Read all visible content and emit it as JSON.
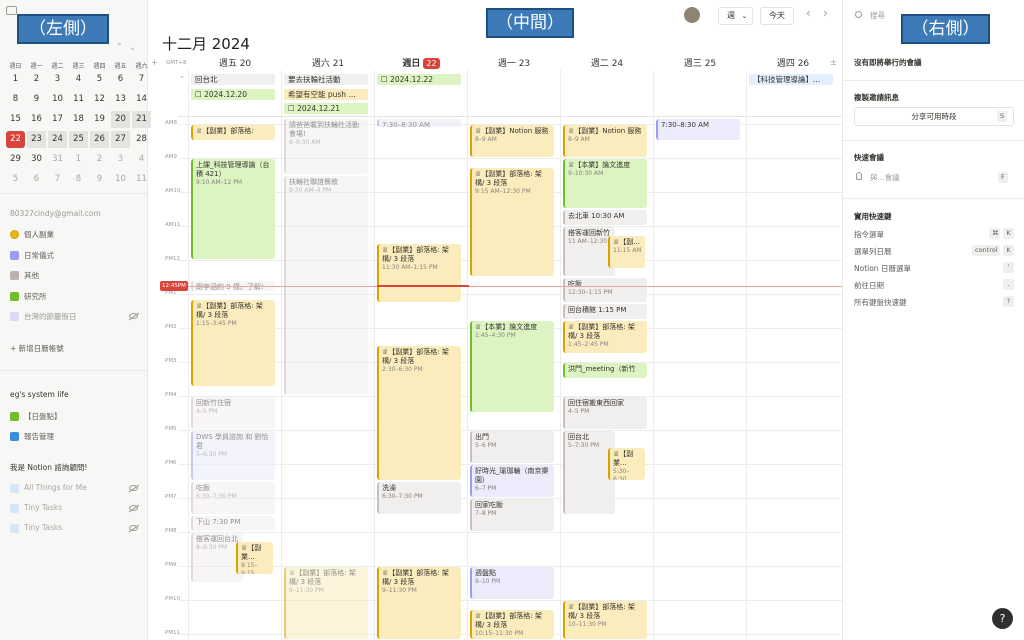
{
  "annotations": {
    "left": "（左側）",
    "center": "（中間）",
    "right": "（右側）"
  },
  "mini_cal": {
    "weekdays": [
      "週日",
      "週一",
      "週二",
      "週三",
      "週四",
      "週五",
      "週六"
    ],
    "days": [
      "1",
      "2",
      "3",
      "4",
      "5",
      "6",
      "7",
      "8",
      "9",
      "10",
      "11",
      "12",
      "13",
      "14",
      "15",
      "16",
      "17",
      "18",
      "19",
      "20",
      "21",
      "22",
      "23",
      "24",
      "25",
      "26",
      "27",
      "28",
      "29",
      "30",
      "31",
      "1",
      "2",
      "3",
      "4",
      "5",
      "6",
      "7",
      "8",
      "9",
      "10",
      "11"
    ]
  },
  "left_sidebar": {
    "account": "80327cindy@gmail.com",
    "calendars": [
      "個人副業",
      "日常儀式",
      "其他",
      "研究所",
      "台灣的節慶假日"
    ],
    "add_calendar": "新增日曆帳號",
    "system_section": "eg's system life",
    "system_items": [
      "【日盤點】",
      "報告管理"
    ],
    "notion_section": "我是 Notion 諮詢顧問!",
    "notion_items": [
      "All Things for Me",
      "Tiny Tasks",
      "Tiny Tasks"
    ]
  },
  "header": {
    "title": "十二月 2024",
    "view": "週",
    "view_caret": "⌄",
    "today": "今天",
    "prev": "‹",
    "next": "›",
    "timezone": "GMT+8",
    "add": "+",
    "collapse": "⌃",
    "expand": "±"
  },
  "columns": [
    {
      "day": "週五 20"
    },
    {
      "day": "週六 21"
    },
    {
      "day": "週日",
      "num": "22"
    },
    {
      "day": "週一 23"
    },
    {
      "day": "週二 24"
    },
    {
      "day": "週三 25"
    },
    {
      "day": "週四 26"
    }
  ],
  "hours": [
    "AM8",
    "AM9",
    "AM10",
    "AM11",
    "PM12",
    "PM1",
    "PM2",
    "PM3",
    "PM4",
    "PM5",
    "PM6",
    "PM7",
    "PM8",
    "PM9",
    "PM10",
    "PM11"
  ],
  "now_label": "12:45PM",
  "allday": [
    {
      "col": 0,
      "row": 0,
      "text": "回台北",
      "c": "gry"
    },
    {
      "col": 0,
      "row": 1,
      "text": "☐ 2024.12.20",
      "c": "grn"
    },
    {
      "col": 1,
      "row": 0,
      "text": "要去扶輪社活動",
      "c": "gry"
    },
    {
      "col": 1,
      "row": 1,
      "text": "希望有空能 push ...",
      "c": "yel"
    },
    {
      "col": 1,
      "row": 2,
      "text": "☐ 2024.12.21",
      "c": "grn"
    },
    {
      "col": 2,
      "row": 0,
      "text": "☐ 2024.12.22",
      "c": "grn"
    },
    {
      "col": 6,
      "row": 0,
      "text": "【科技管理導論】...",
      "c": "blu"
    }
  ],
  "events": [
    {
      "col": 0,
      "s": 8.0,
      "e": 8.5,
      "t": "♕【副業】部落格:",
      "tm": "",
      "c": "yel stripe"
    },
    {
      "col": 0,
      "s": 9.0,
      "e": 12.0,
      "t": "上課_科技管理導論（台積 421）",
      "tm": "9:10 AM–12 PM",
      "c": "grn stripeg"
    },
    {
      "col": 0,
      "s": 12.6,
      "e": 12.95,
      "t": "跟宇涵約 9 樣。了解!",
      "tm": "",
      "c": "gry stripegr faded"
    },
    {
      "col": 0,
      "s": 13.15,
      "e": 15.75,
      "t": "♕【副業】部落格: 架構/ 3 段落",
      "tm": "1:15–3:45 PM",
      "c": "yel stripe"
    },
    {
      "col": 0,
      "s": 16.0,
      "e": 17.0,
      "t": "回新竹住宿",
      "tm": "4–5 PM",
      "c": "gry stripegr faded"
    },
    {
      "col": 0,
      "s": 17.0,
      "e": 18.5,
      "t": "DWS 學員諮詢 和 劉怡君",
      "tm": "5–6:30 PM",
      "c": "pur stripep faded"
    },
    {
      "col": 0,
      "s": 18.5,
      "e": 19.5,
      "t": "吃飯",
      "tm": "6:30–7:30 PM",
      "c": "gry stripegr faded"
    },
    {
      "col": 0,
      "s": 19.5,
      "e": 20.0,
      "t": "下山 7:30 PM",
      "tm": "",
      "c": "gry stripegr faded"
    },
    {
      "col": 0,
      "s": 20.0,
      "e": 21.5,
      "t": "搭客運回台北",
      "tm": "8–9:30 PM",
      "c": "gry stripegr faded"
    },
    {
      "col": 0,
      "s": 20.25,
      "e": 21.25,
      "t": "♕【副業...",
      "tm": "8:15–9:15",
      "c": "yel stripe",
      "half": true
    },
    {
      "col": 1,
      "s": 7.8,
      "e": 9.5,
      "t": "請爸爸載到扶輪社活動會場!",
      "tm": "8–9:30 AM",
      "c": "gry stripegr faded"
    },
    {
      "col": 1,
      "s": 9.5,
      "e": 16.0,
      "t": "扶輪社聯誼餐敘",
      "tm": "9:30 AM–4 PM",
      "c": "gry stripegr faded"
    },
    {
      "col": 1,
      "s": 21.0,
      "e": 24.0,
      "t": "♕【副業】部落格: 架構/ 3 段落",
      "tm": "9–11:30 PM",
      "c": "yel stripe faded"
    },
    {
      "col": 2,
      "s": 7.8,
      "e": 8.1,
      "t": "7:30–8:30 AM",
      "tm": "",
      "c": "pur stripep faded"
    },
    {
      "col": 2,
      "s": 11.5,
      "e": 13.25,
      "t": "♕【副業】部落格: 架構/ 3 段落",
      "tm": "11:30 AM–1:15 PM",
      "c": "yel stripe"
    },
    {
      "col": 2,
      "s": 14.5,
      "e": 18.5,
      "t": "♕【副業】部落格: 架構/ 3 段落",
      "tm": "2:30–6:30 PM",
      "c": "yel stripe"
    },
    {
      "col": 2,
      "s": 18.5,
      "e": 19.5,
      "t": "洗澡",
      "tm": "6:30–7:30 PM",
      "c": "gry stripegr"
    },
    {
      "col": 2,
      "s": 21.0,
      "e": 24.0,
      "t": "♕【副業】部落格: 架構/ 3 段落",
      "tm": "9–11:30 PM",
      "c": "yel stripe"
    },
    {
      "col": 3,
      "s": 8.0,
      "e": 9.0,
      "t": "♕【副業】Notion 服務",
      "tm": "8–9 AM",
      "c": "yel stripe"
    },
    {
      "col": 3,
      "s": 9.25,
      "e": 12.5,
      "t": "♕【副業】部落格: 架構/ 3 段落",
      "tm": "9:15 AM–12:30 PM",
      "c": "yel stripe"
    },
    {
      "col": 3,
      "s": 13.75,
      "e": 16.5,
      "t": "♕【本業】論文進度",
      "tm": "1:45–4:30 PM",
      "c": "grn stripeg"
    },
    {
      "col": 3,
      "s": 17.0,
      "e": 18.0,
      "t": "出門",
      "tm": "5–6 PM",
      "c": "gry stripegr"
    },
    {
      "col": 3,
      "s": 18.0,
      "e": 19.0,
      "t": "好時光_瑜珈輪（南京樂園）",
      "tm": "6–7 PM",
      "c": "pur stripep"
    },
    {
      "col": 3,
      "s": 19.0,
      "e": 20.0,
      "t": "回家吃飯",
      "tm": "7–8 PM",
      "c": "gry stripegr"
    },
    {
      "col": 3,
      "s": 21.0,
      "e": 22.0,
      "t": "週盤點",
      "tm": "9–10 PM",
      "c": "pur stripep"
    },
    {
      "col": 3,
      "s": 22.25,
      "e": 24.0,
      "t": "♕【副業】部落格: 架構/ 3 段落",
      "tm": "10:15–11:30 PM",
      "c": "yel stripe"
    },
    {
      "col": 4,
      "s": 8.0,
      "e": 9.0,
      "t": "♕【副業】Notion 服務",
      "tm": "8–9 AM",
      "c": "yel stripe"
    },
    {
      "col": 4,
      "s": 9.0,
      "e": 10.5,
      "t": "♕【本業】論文進度",
      "tm": "9–10:30 AM",
      "c": "grn stripeg"
    },
    {
      "col": 4,
      "s": 10.5,
      "e": 11.0,
      "t": "去北車 10:30 AM",
      "tm": "",
      "c": "gry stripegr"
    },
    {
      "col": 4,
      "s": 11.0,
      "e": 12.5,
      "t": "搭客運回新竹",
      "tm": "11 AM–12:30",
      "c": "gry stripegr"
    },
    {
      "col": 4,
      "s": 11.25,
      "e": 12.25,
      "t": "♕【副...",
      "tm": "11:15 AM",
      "c": "yel stripe",
      "half": true
    },
    {
      "col": 4,
      "s": 12.5,
      "e": 13.25,
      "t": "吃飯",
      "tm": "12:30–1:15 PM",
      "c": "gry stripegr"
    },
    {
      "col": 4,
      "s": 13.25,
      "e": 13.75,
      "t": "回台積館 1:15 PM",
      "tm": "",
      "c": "gry stripegr"
    },
    {
      "col": 4,
      "s": 13.75,
      "e": 14.75,
      "t": "♕【副業】部落格: 架構/ 3 段落",
      "tm": "1:45–2:45 PM",
      "c": "yel stripe"
    },
    {
      "col": 4,
      "s": 15.0,
      "e": 15.5,
      "t": "洪門_meeting（新竹",
      "tm": "",
      "c": "grn stripeg"
    },
    {
      "col": 4,
      "s": 16.0,
      "e": 17.0,
      "t": "回住宿搬東西回家",
      "tm": "4–5 PM",
      "c": "gry stripegr"
    },
    {
      "col": 4,
      "s": 17.0,
      "e": 19.5,
      "t": "回台北",
      "tm": "5–7:30 PM",
      "c": "gry stripegr"
    },
    {
      "col": 4,
      "s": 17.5,
      "e": 18.5,
      "t": "♕【副業...",
      "tm": "5:30–6:30",
      "c": "yel stripe",
      "half": true
    },
    {
      "col": 4,
      "s": 22.0,
      "e": 24.0,
      "t": "♕【副業】部落格: 架構/ 3 段落",
      "tm": "10–11:30 PM",
      "c": "yel stripe"
    },
    {
      "col": 5,
      "s": 7.8,
      "e": 8.5,
      "t": "7:30–8:30 AM",
      "tm": "",
      "c": "pur stripep"
    }
  ],
  "right_sidebar": {
    "search": "搜尋",
    "no_meetings": "沒有即將舉行的會議",
    "copy_invite": "複製邀請訊息",
    "share_button": "分享可用時段",
    "share_key": "S",
    "quick_meeting": "快速會議",
    "quick_with": "與...會議",
    "quick_key": "F",
    "shortcuts_title": "實用快速鍵",
    "shortcuts": [
      {
        "label": "指令選單",
        "keys": [
          "⌘",
          "K"
        ]
      },
      {
        "label": "選單列日曆",
        "keys": [
          "control",
          "K"
        ]
      },
      {
        "label": "Notion 日曆選單",
        "keys": [
          "'"
        ]
      },
      {
        "label": "前往日期",
        "keys": [
          "."
        ]
      },
      {
        "label": "所有鍵盤快速鍵",
        "keys": [
          "?"
        ]
      }
    ]
  },
  "help": "?",
  "colors": {
    "today": "#d9453b",
    "accent": "#3d7ab8"
  }
}
